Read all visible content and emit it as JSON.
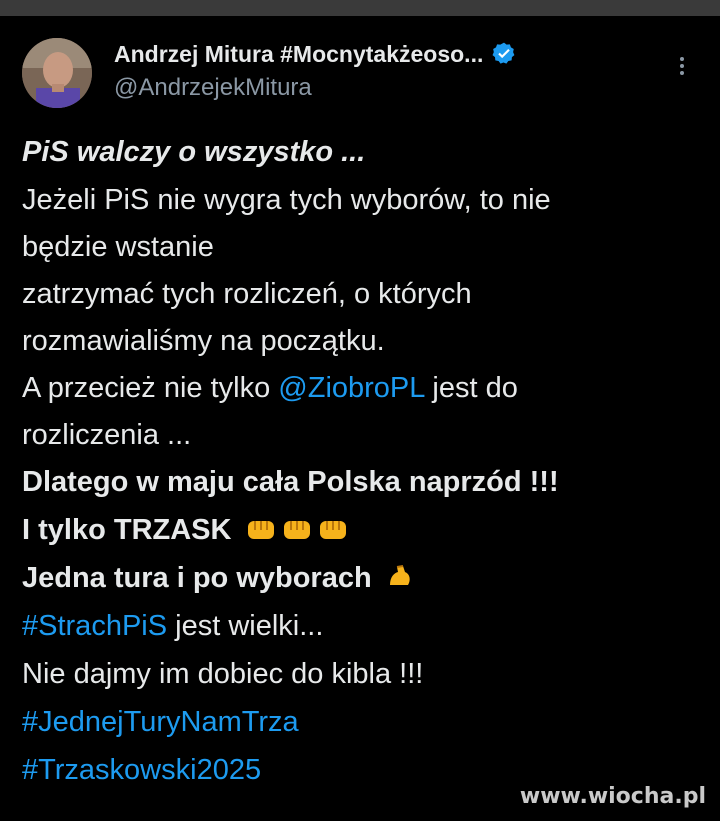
{
  "author": {
    "display_name": "Andrzej Mitura #Mocnytakżeoso...",
    "handle": "@AndrzejekMitura",
    "verified_icon": "verified-badge-icon",
    "accent_color": "#1d9bf0"
  },
  "tweet": {
    "line1": "PiS walczy o wszystko ...",
    "line2": "Jeżeli PiS nie wygra tych wyborów, to nie",
    "line3": "będzie wstanie",
    "line4": "zatrzymać tych rozliczeń, o których",
    "line5": "rozmawialiśmy na początku.",
    "line6_pre": "A przecież nie tylko ",
    "line6_mention": "@ZiobroPL",
    "line6_post": " jest do",
    "line7": "rozliczenia ...",
    "line8": "Dlatego w maju cała Polska naprzód !!!",
    "line9": "I tylko TRZASK",
    "line10": "Jedna tura i po wyborach",
    "line11_hashtag": "#StrachPiS",
    "line11_post": " jest wielki...",
    "line12": "Nie dajmy im dobiec do kibla !!!",
    "line13_hashtag": "#JednejTuryNamTrza",
    "line14_hashtag": "#Trzaskowski2025",
    "fist_icons": [
      "fist-emoji-icon",
      "fist-emoji-icon",
      "fist-emoji-icon"
    ],
    "muscle_icon": "flexed-biceps-emoji-icon"
  },
  "watermark": "www.wiocha.pl"
}
